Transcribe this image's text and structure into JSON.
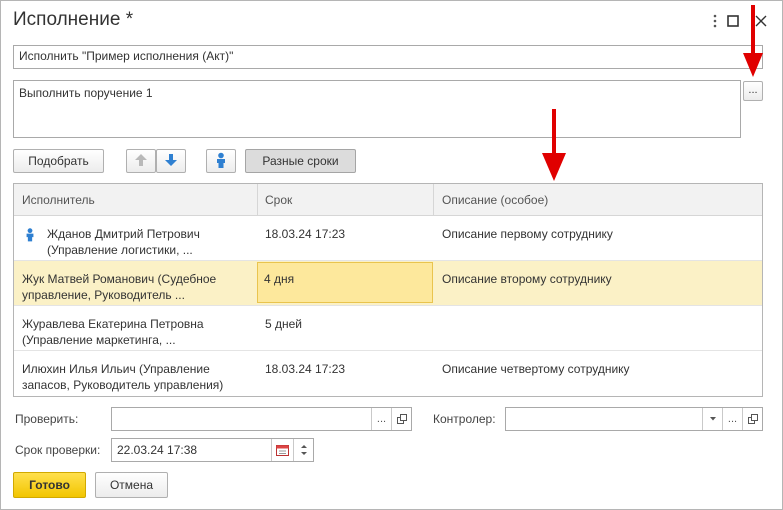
{
  "window": {
    "title": "Исполнение *",
    "menu_icon": "more-vertical-icon",
    "maximize_icon": "maximize-icon",
    "close_icon": "close-icon"
  },
  "subject": {
    "value": "Исполнить \"Пример исполнения (Акт)\""
  },
  "description": {
    "value": "Выполнить поручение 1",
    "more_button": "..."
  },
  "toolbar": {
    "pick_label": "Подобрать",
    "move_up_icon": "arrow-up-icon",
    "move_down_icon": "arrow-down-icon",
    "person_icon": "person-icon",
    "different_dates_label": "Разные сроки"
  },
  "table": {
    "columns": [
      "Исполнитель",
      "Срок",
      "Описание (особое)"
    ],
    "rows": [
      {
        "executor": "Жданов Дмитрий Петрович (Управление логистики, ...",
        "deadline": "18.03.24 17:23",
        "description": "Описание первому сотруднику",
        "has_icon": true,
        "selected": false
      },
      {
        "executor": "Жук Матвей Романович (Судебное управление, Руководитель ...",
        "deadline": "4 дня",
        "description": "Описание второму сотруднику",
        "has_icon": false,
        "selected": true
      },
      {
        "executor": "Журавлева Екатерина Петровна (Управление маркетинга, ...",
        "deadline": "5 дней",
        "description": "",
        "has_icon": false,
        "selected": false
      },
      {
        "executor": "Илюхин Илья Ильич (Управление запасов, Руководитель управления)",
        "deadline": "18.03.24 17:23",
        "description": "Описание четвертому сотруднику",
        "has_icon": false,
        "selected": false
      }
    ]
  },
  "check": {
    "label": "Проверить:",
    "value": "",
    "controller_label": "Контролер:",
    "controller_value": "",
    "ellipsis": "...",
    "deadline_label": "Срок проверки:",
    "deadline_value": "22.03.24 17:38"
  },
  "footer": {
    "ok_label": "Готово",
    "cancel_label": "Отмена"
  },
  "colors": {
    "accent": "#f2c500",
    "selected_row": "#fbf1c6",
    "edit_cell": "#fde89c",
    "annotation_arrow": "#e00000",
    "icon_blue": "#2f80d1"
  }
}
